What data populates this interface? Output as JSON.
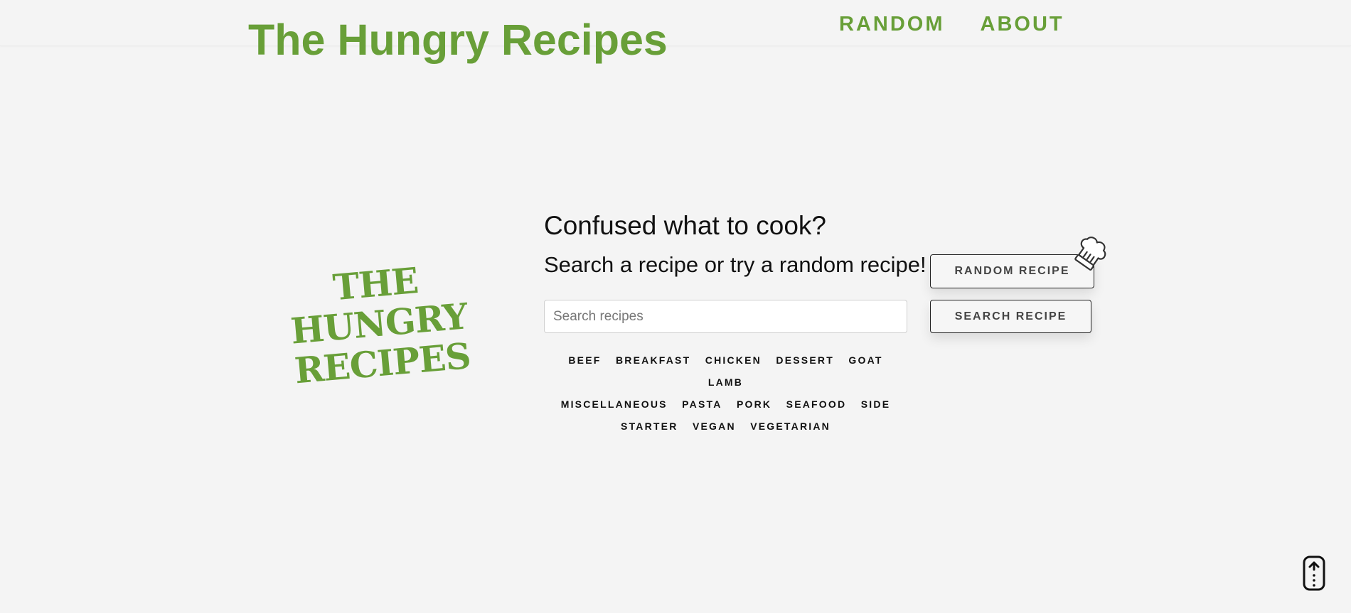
{
  "header": {
    "title": "The Hungry Recipes",
    "nav": [
      "RANDOM",
      "ABOUT"
    ]
  },
  "logo": {
    "line1": "THE HUNGRY",
    "line2": "RECIPES"
  },
  "main": {
    "heading": "Confused what to cook?",
    "subheading": "Search a recipe or try a random recipe!",
    "search": {
      "placeholder": "Search recipes",
      "value": ""
    },
    "random_button": "RANDOM RECIPE",
    "search_button": "SEARCH RECIPE",
    "categories": [
      "BEEF",
      "BREAKFAST",
      "CHICKEN",
      "DESSERT",
      "GOAT",
      "LAMB",
      "MISCELLANEOUS",
      "PASTA",
      "PORK",
      "SEAFOOD",
      "SIDE",
      "STARTER",
      "VEGAN",
      "VEGETARIAN"
    ]
  },
  "icons": {
    "chef_hat": "chef-hat-icon",
    "scroll_top": "scroll-to-top-icon"
  },
  "colors": {
    "accent": "#689f38",
    "background": "#f4f4f4",
    "text": "#111111"
  }
}
